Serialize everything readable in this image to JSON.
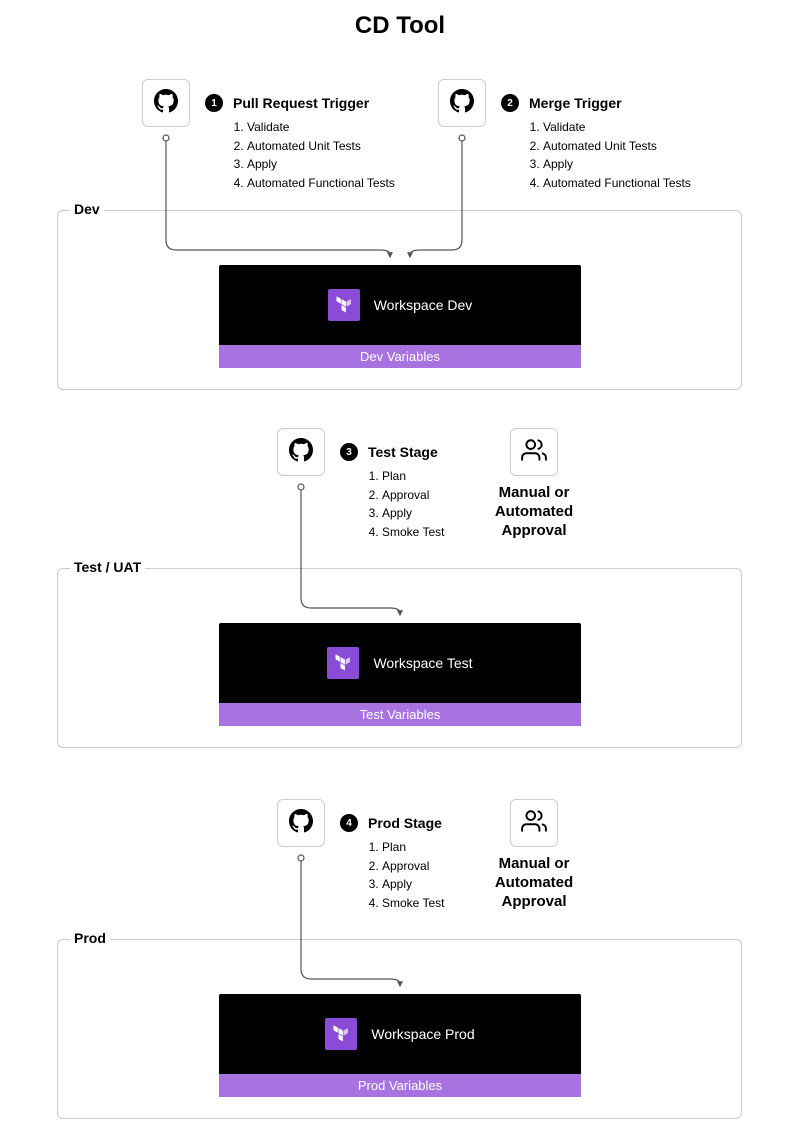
{
  "title": "CD Tool",
  "triggers": {
    "pr": {
      "badge": "1",
      "name": "Pull Request Trigger",
      "steps": [
        "Validate",
        "Automated Unit Tests",
        "Apply",
        "Automated Functional Tests"
      ]
    },
    "merge": {
      "badge": "2",
      "name": "Merge Trigger",
      "steps": [
        "Validate",
        "Automated Unit Tests",
        "Apply",
        "Automated Functional Tests"
      ]
    },
    "test": {
      "badge": "3",
      "name": "Test Stage",
      "steps": [
        "Plan",
        "Approval",
        "Apply",
        "Smoke Test"
      ]
    },
    "prod": {
      "badge": "4",
      "name": "Prod Stage",
      "steps": [
        "Plan",
        "Approval",
        "Apply",
        "Smoke Test"
      ]
    }
  },
  "approval": {
    "test": "Manual or Automated Approval",
    "prod": "Manual or Automated Approval"
  },
  "stages": {
    "dev": {
      "label": "Dev",
      "workspace": "Workspace Dev",
      "variables": "Dev Variables"
    },
    "test": {
      "label": "Test / UAT",
      "workspace": "Workspace Test",
      "variables": "Test Variables"
    },
    "prod": {
      "label": "Prod",
      "workspace": "Workspace Prod",
      "variables": "Prod Variables"
    }
  }
}
